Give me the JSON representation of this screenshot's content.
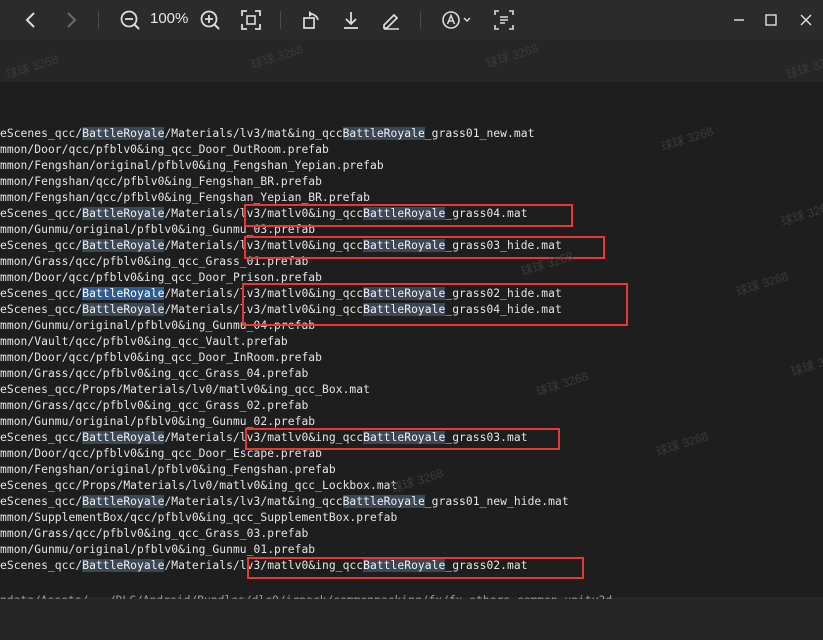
{
  "toolbar": {
    "back_icon": "chevron-left-icon",
    "forward_icon": "chevron-right-icon",
    "zoom_out_icon": "zoom-out-icon",
    "zoom_level": "100%",
    "zoom_in_icon": "zoom-in-icon",
    "fit_icon": "fit-screen-icon",
    "rotate_icon": "rotate-icon",
    "download_icon": "download-icon",
    "edit_icon": "pen-icon",
    "ocr_icon": "text-recognize-icon",
    "scan_icon": "scan-text-icon"
  },
  "window": {
    "minimize_icon": "minimize-icon",
    "maximize_icon": "maximize-icon",
    "close_icon": "close-icon"
  },
  "watermark": "球球 3268",
  "lines": [
    [
      "eScenes_qcc/",
      "BattleRoyale",
      "/Materials/lv3/mat&ing_qcc",
      "BattleRoyale",
      "_grass01_new.mat"
    ],
    [
      "mmon/Door/qcc/pfblv0&ing_qcc_Door_OutRoom.prefab"
    ],
    [
      "mmon/Fengshan/original/pfblv0&ing_Fengshan_Yepian.prefab"
    ],
    [
      "mmon/Fengshan/qcc/pfblv0&ing_Fengshan_BR.prefab"
    ],
    [
      "mmon/Fengshan/qcc/pfblv0&ing_Fengshan_Yepian_BR.prefab"
    ],
    [
      "eScenes_qcc/",
      "BattleRoyale",
      "/Materials/lv3/matlv0&ing_qcc",
      "BattleRoyale",
      "_grass04.mat"
    ],
    [
      "mmon/Gunmu/original/pfblv0&ing_Gunmu_03.prefab"
    ],
    [
      "eScenes_qcc/",
      "BattleRoyale",
      "/Materials/lv3/matlv0&ing_qcc",
      "BattleRoyale",
      "_grass03_hide.mat"
    ],
    [
      "mmon/Grass/qcc/pfblv0&ing_qcc_Grass_01.prefab"
    ],
    [
      "mmon/Door/qcc/pfblv0&ing_qcc_Door_Prison.prefab"
    ],
    [
      "eScenes_qcc/",
      "BattleRoyale",
      "/Materials/lv3/matlv0&ing_qcc",
      "BattleRoyale",
      "_grass02_hide.mat"
    ],
    [
      "eScenes_qcc/",
      "BattleRoyale",
      "/Materials/lv3/matlv0&ing_qcc",
      "BattleRoyale",
      "_grass04_hide.mat"
    ],
    [
      "mmon/Gunmu/original/pfblv0&ing_Gunmu_04.prefab"
    ],
    [
      "mmon/Vault/qcc/pfblv0&ing_qcc_Vault.prefab"
    ],
    [
      "mmon/Door/qcc/pfblv0&ing_qcc_Door_InRoom.prefab"
    ],
    [
      "mmon/Grass/qcc/pfblv0&ing_qcc_Grass_04.prefab"
    ],
    [
      "eScenes_qcc/Props/Materials/lv0/matlv0&ing_qcc_Box.mat"
    ],
    [
      "mmon/Grass/qcc/pfblv0&ing_qcc_Grass_02.prefab"
    ],
    [
      "mmon/Gunmu/original/pfblv0&ing_Gunmu_02.prefab"
    ],
    [
      "eScenes_qcc/",
      "BattleRoyale",
      "/Materials/lv3/matlv0&ing_qcc",
      "BattleRoyale",
      "_grass03.mat"
    ],
    [
      "mmon/Door/qcc/pfblv0&ing_qcc_Door_Escape.prefab"
    ],
    [
      "mmon/Fengshan/original/pfblv0&ing_Fengshan.prefab"
    ],
    [
      "eScenes_qcc/Props/Materials/lv0/matlv0&ing_qcc_Lockbox.mat"
    ],
    [
      "eScenes_qcc/",
      "BattleRoyale",
      "/Materials/lv3/mat&ing_qcc",
      "BattleRoyale",
      "_grass01_new_hide.mat"
    ],
    [
      "mmon/SupplementBox/qcc/pfblv0&ing_qcc_SupplementBox.prefab"
    ],
    [
      "mmon/Grass/qcc/pfblv0&ing_qcc_Grass_03.prefab"
    ],
    [
      "mmon/Gunmu/original/pfblv0&ing_Gunmu_01.prefab"
    ],
    [
      "eScenes_qcc/",
      "BattleRoyale",
      "/Materials/lv3/matlv0&ing_qcc",
      "BattleRoyale",
      "_grass02.mat"
    ]
  ],
  "tail_line": "ndata/Assets/.../DLC/Android/Bundles/dlc0/irpack/commonpacking/fx/fx_others_common_unity3d",
  "colors": {
    "highlight": "#3b4754",
    "selected_highlight": "#2f5b8c",
    "annotation_box": "#e53935"
  }
}
